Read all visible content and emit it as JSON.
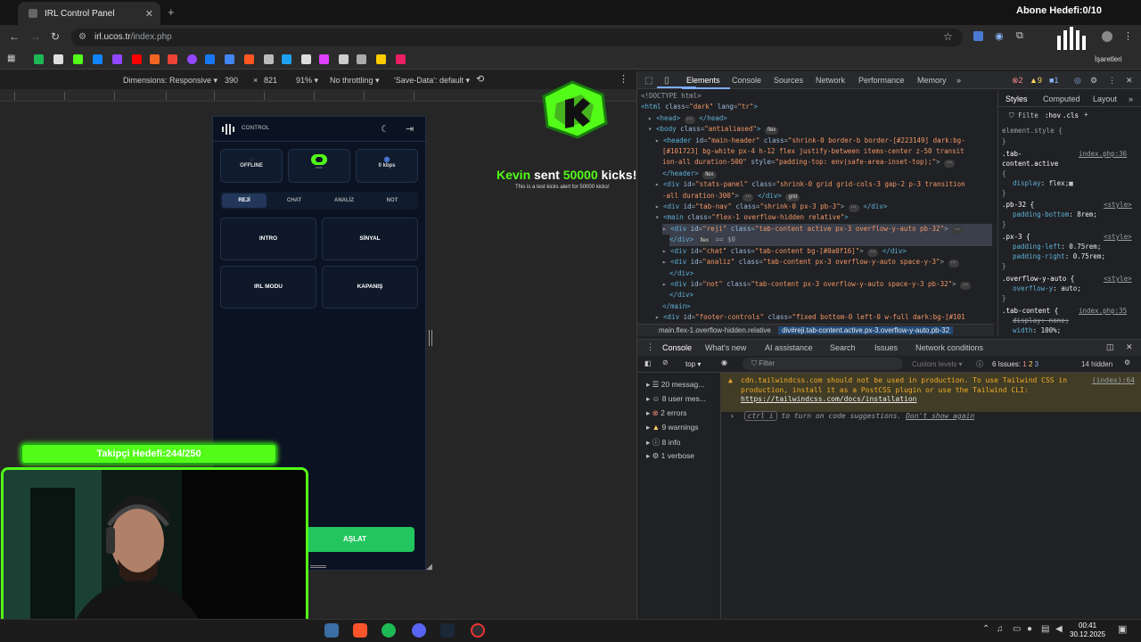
{
  "browser": {
    "tab_title": "IRL Control Panel",
    "tab_close": "✕",
    "new_tab": "+",
    "url_host": "irl.ucos.tr",
    "url_path": "/index.php",
    "overlay_goal": "Abone Hedefi:0/10",
    "bookmarks_label": "İşaretleri"
  },
  "device_toolbar": {
    "dimensions": "Dimensions: Responsive ▾",
    "width": "390",
    "x": "×",
    "height": "821",
    "zoom": "91% ▾",
    "throttle": "No throttling ▾",
    "save_data": "'Save-Data': default ▾"
  },
  "app": {
    "title": "CONTROL",
    "status_offline": "OFFLINE",
    "kick_label": "KICK",
    "kbps": "0 kbps",
    "tabs": [
      "REJİ",
      "CHAT",
      "ANALİZ",
      "NOT"
    ],
    "actions": [
      "INTRO",
      "SİNYAL",
      "IRL MODU",
      "KAPANIŞ"
    ],
    "start_label": "AŞLAT"
  },
  "alert": {
    "name": "Kevin",
    "sent": " sent ",
    "amount": "50000",
    "suffix": " kicks!",
    "sub": "This is a test kicks alert for 50000 kicks!"
  },
  "overlay": {
    "follower_goal": "Takipçi Hedefi:244/250"
  },
  "devtools": {
    "tabs": [
      "Elements",
      "Console",
      "Sources",
      "Network",
      "Performance",
      "Memory",
      "»"
    ],
    "errors": "2",
    "warnings": "9",
    "info": "1",
    "styles_tabs": [
      "Styles",
      "Computed",
      "Layout",
      "»"
    ],
    "filter": "Filte",
    "hov": ":hov",
    "cls": ".cls",
    "breadcrumb_1": "main.flex-1.overflow-hidden.relative",
    "breadcrumb_2": "div#reji.tab-content.active.px-3.overflow-y-auto.pb-32",
    "drawer_tabs": [
      "Console",
      "What's new",
      "AI assistance",
      "Search",
      "Issues",
      "Network conditions"
    ],
    "context": "top ▾",
    "filter_placeholder": "Filter",
    "levels": "Custom levels ▾",
    "issues": "6 Issues:",
    "issue_counts": [
      "1",
      "2",
      "3"
    ],
    "hidden": "14 hidden",
    "sidebar": [
      {
        "icon": "list-icon",
        "label": "20 messag..."
      },
      {
        "icon": "user-icon",
        "label": "8 user mes..."
      },
      {
        "icon": "error-icon",
        "label": "2 errors"
      },
      {
        "icon": "warning-icon",
        "label": "9 warnings"
      },
      {
        "icon": "info-icon",
        "label": "8 info"
      },
      {
        "icon": "verbose-icon",
        "label": "1 verbose"
      }
    ],
    "message": "cdn.tailwindcss.com should not be used in production. To use Tailwind CSS in production, install it as a PostCSS plugin or use the Tailwind CLI:",
    "message_link": "https://tailwindcss.com/docs/installation",
    "message_src": "(index):64",
    "hint_keys": "ctrl  i",
    "hint_text": "to turn on code suggestions.",
    "hint_dismiss": "Don't show again"
  },
  "taskbar": {
    "time": "00:41",
    "date": "30.12.2025"
  }
}
